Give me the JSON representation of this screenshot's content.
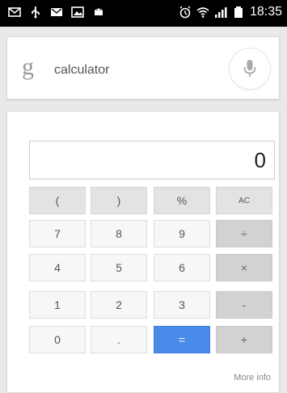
{
  "status_bar": {
    "time": "18:35",
    "left_icons": [
      "email-icon",
      "usb-icon",
      "gmail-icon",
      "image-icon",
      "android-icon"
    ],
    "right_icons": [
      "alarm-icon",
      "wifi-icon",
      "signal-icon",
      "battery-icon"
    ]
  },
  "search": {
    "logo": "g",
    "query": "calculator",
    "mic_icon": "microphone-icon"
  },
  "calculator": {
    "display": "0",
    "rows": [
      [
        "(",
        ")",
        "%",
        "AC"
      ],
      [
        "7",
        "8",
        "9",
        "÷"
      ],
      [
        "4",
        "5",
        "6",
        "×"
      ],
      [
        "1",
        "2",
        "3",
        "-"
      ],
      [
        "0",
        ".",
        "=",
        "+"
      ]
    ],
    "more_info": "More info"
  },
  "colors": {
    "equals_key": "#4a8ae8",
    "operator_key": "#d2d2d2",
    "top_row_key": "#e3e3e3"
  }
}
